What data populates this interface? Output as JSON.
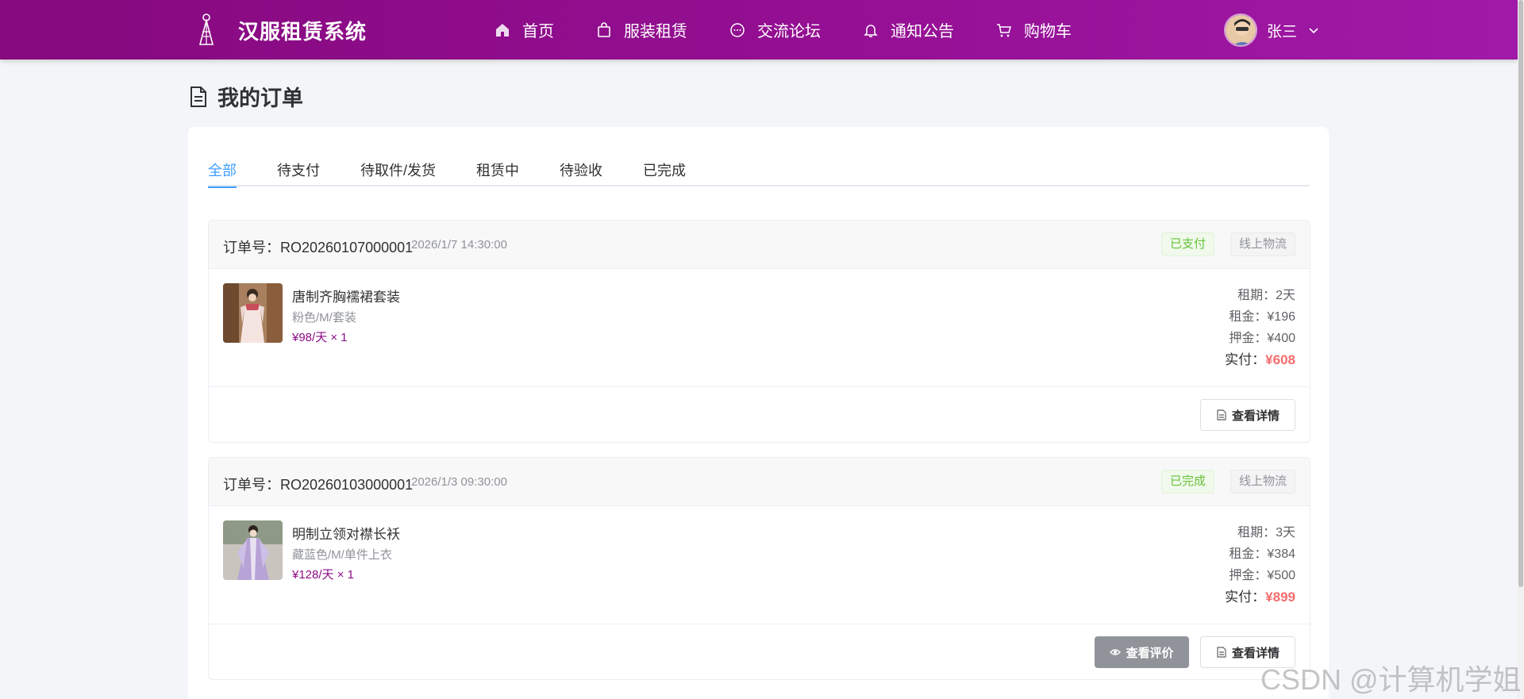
{
  "header": {
    "brand_title": "汉服租赁系统",
    "nav": [
      {
        "label": "首页",
        "icon": "home-icon"
      },
      {
        "label": "服装租赁",
        "icon": "bag-icon"
      },
      {
        "label": "交流论坛",
        "icon": "chat-icon"
      },
      {
        "label": "通知公告",
        "icon": "bell-icon"
      },
      {
        "label": "购物车",
        "icon": "cart-icon"
      }
    ],
    "user_name": "张三"
  },
  "page_title": "我的订单",
  "tabs": [
    "全部",
    "待支付",
    "待取件/发货",
    "租赁中",
    "待验收",
    "已完成"
  ],
  "active_tab": "全部",
  "orders": [
    {
      "order_no": "订单号：RO20260107000001",
      "time": "2026/1/7 14:30:00",
      "status": "已支付",
      "shipping": "线上物流",
      "item_name": "唐制齐胸襦裙套装",
      "item_spec": "粉色/M/套装",
      "item_price": "¥98/天 × 1",
      "period": "租期：2天",
      "rent": "租金：¥196",
      "deposit": "押金：¥400",
      "paid_label": "实付：",
      "paid_amount": "¥608",
      "detail_btn": "查看详情"
    },
    {
      "order_no": "订单号：RO20260103000001",
      "time": "2026/1/3 09:30:00",
      "status": "已完成",
      "shipping": "线上物流",
      "item_name": "明制立领对襟长袄",
      "item_spec": "藏蓝色/M/单件上衣",
      "item_price": "¥128/天 × 1",
      "period": "租期：3天",
      "rent": "租金：¥384",
      "deposit": "押金：¥500",
      "paid_label": "实付：",
      "paid_amount": "¥899",
      "review_btn": "查看评价",
      "detail_btn": "查看详情"
    }
  ],
  "watermark": "CSDN @计算机学姐",
  "colors": {
    "header_start": "#86097e",
    "header_end": "#a01aa8",
    "accent": "#409eff",
    "price": "#8e0c88",
    "paid_amount": "#f56c6c",
    "status_green": "#67c23a"
  }
}
